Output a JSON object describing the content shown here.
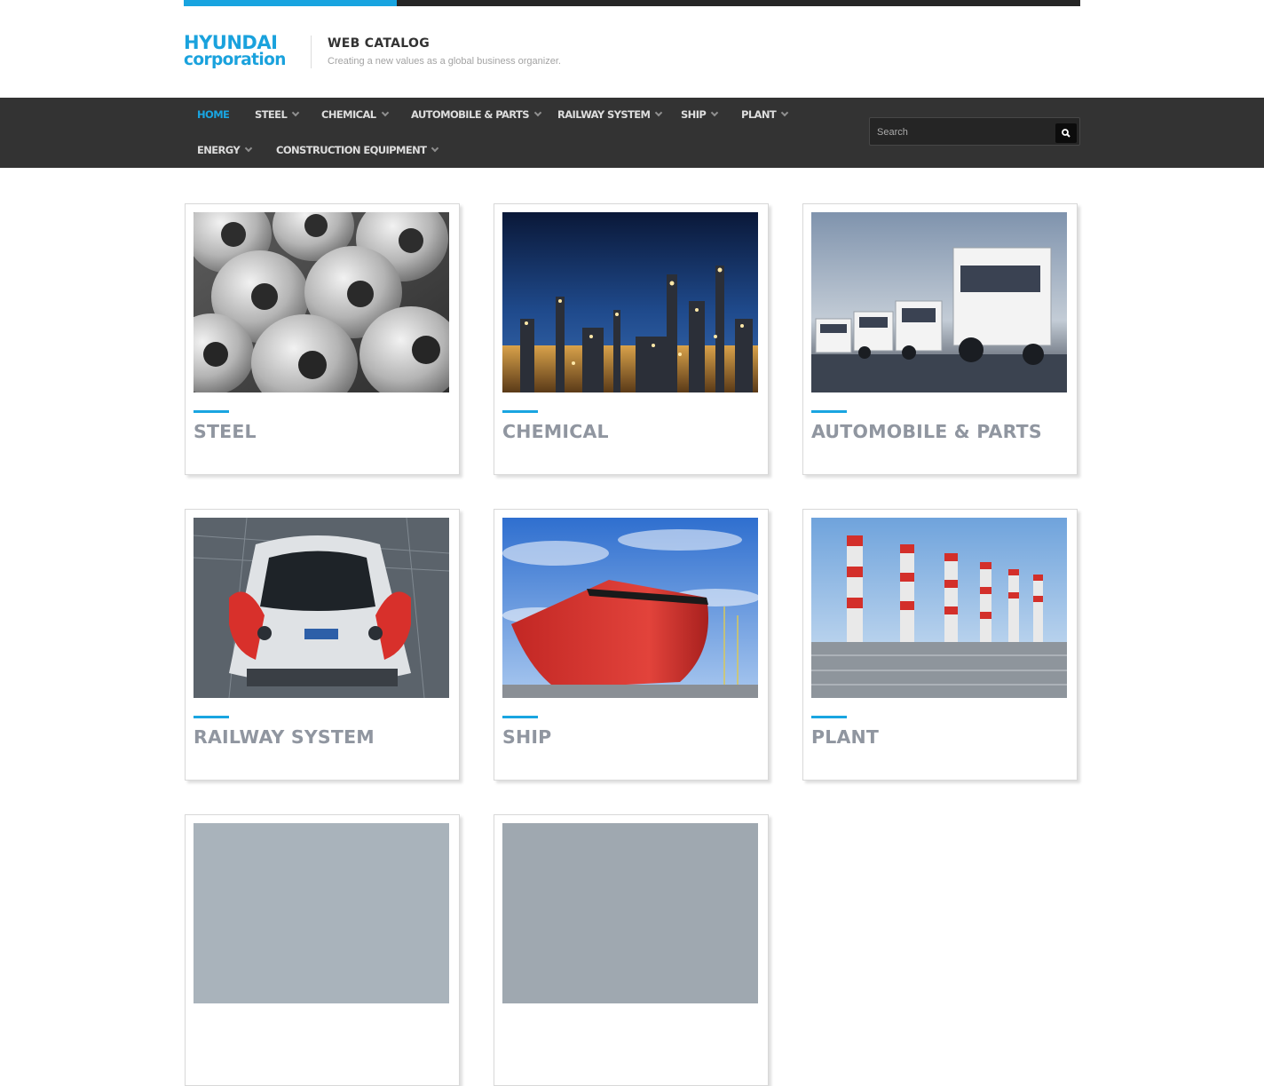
{
  "header": {
    "logo_line1": "HYUNDAI",
    "logo_line2": "corporation",
    "title": "WEB CATALOG",
    "subtitle": "Creating a new values as a global business organizer."
  },
  "nav": {
    "items": [
      {
        "label": "HOME",
        "active": true
      },
      {
        "label": "STEEL"
      },
      {
        "label": "CHEMICAL"
      },
      {
        "label": "AUTOMOBILE & PARTS"
      },
      {
        "label": "RAILWAY SYSTEM"
      },
      {
        "label": "SHIP"
      },
      {
        "label": "PLANT"
      },
      {
        "label": "ENERGY"
      },
      {
        "label": "CONSTRUCTION EQUIPMENT"
      }
    ],
    "search_placeholder": "Search"
  },
  "categories": [
    {
      "label": "STEEL",
      "image": "steel-coils-image"
    },
    {
      "label": "CHEMICAL",
      "image": "chemical-plant-night-image"
    },
    {
      "label": "AUTOMOBILE & PARTS",
      "image": "trucks-image"
    },
    {
      "label": "RAILWAY SYSTEM",
      "image": "train-image"
    },
    {
      "label": "SHIP",
      "image": "ship-hull-image"
    },
    {
      "label": "PLANT",
      "image": "power-plant-chimneys-image"
    }
  ],
  "colors": {
    "accent": "#19a5e1",
    "nav_bg": "#333333",
    "label_gray": "#9096a0"
  }
}
